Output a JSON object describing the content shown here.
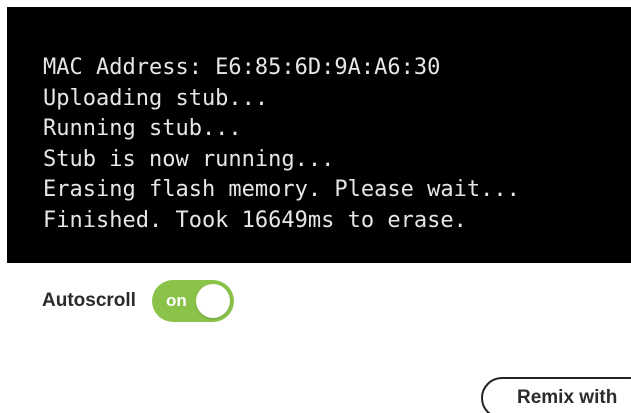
{
  "console": {
    "lines": [
      "MAC Address: E6:85:6D:9A:A6:30",
      "Uploading stub...",
      "Running stub...",
      "Stub is now running...",
      "Erasing flash memory. Please wait...",
      "Finished. Took 16649ms to erase."
    ]
  },
  "autoscroll": {
    "label": "Autoscroll",
    "state_label": "on",
    "enabled": true
  },
  "actions": {
    "remix_label": "Remix with"
  },
  "colors": {
    "console_background": "#000000",
    "console_text": "#e6e6e6",
    "toggle_on": "#8bc34a"
  }
}
